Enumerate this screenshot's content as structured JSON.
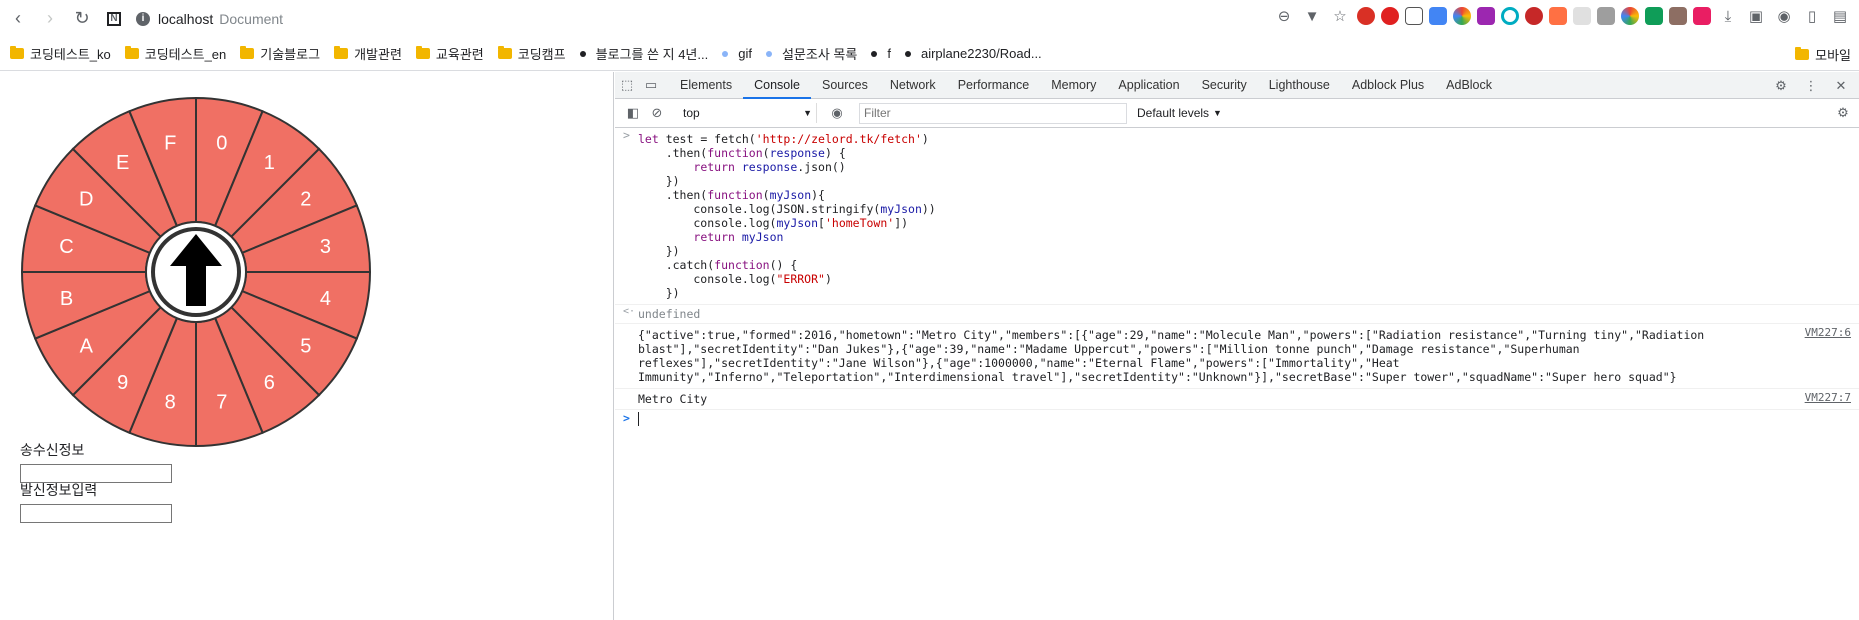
{
  "browser": {
    "host": "localhost",
    "page_title": "Document"
  },
  "bookmarks": [
    {
      "label": "코딩테스트_ko",
      "icon": "folder"
    },
    {
      "label": "코딩테스트_en",
      "icon": "folder"
    },
    {
      "label": "기술블로그",
      "icon": "folder"
    },
    {
      "label": "개발관련",
      "icon": "folder"
    },
    {
      "label": "교육관련",
      "icon": "folder"
    },
    {
      "label": "코딩캠프",
      "icon": "folder"
    },
    {
      "label": "블로그를 쓴 지 4년...",
      "icon": "dot-black"
    },
    {
      "label": "gif",
      "icon": "dot-blue"
    },
    {
      "label": "설문조사 목록",
      "icon": "dot-blue"
    },
    {
      "label": "f",
      "icon": "dot-black"
    },
    {
      "label": "airplane2230/Road...",
      "icon": "dot-black"
    }
  ],
  "bookmarks_right": {
    "label": "모바일",
    "icon": "folder"
  },
  "wheel": {
    "segments": [
      "0",
      "1",
      "2",
      "3",
      "4",
      "5",
      "6",
      "7",
      "8",
      "9",
      "A",
      "B",
      "C",
      "D",
      "E",
      "F"
    ],
    "fill": "#f07064",
    "stroke": "#333333"
  },
  "form": {
    "recv_label": "송수신정보",
    "recv_value": "",
    "send_label": "발신정보입력",
    "send_value": ""
  },
  "devtools": {
    "tabs": [
      "Elements",
      "Console",
      "Sources",
      "Network",
      "Performance",
      "Memory",
      "Application",
      "Security",
      "Lighthouse",
      "Adblock Plus",
      "AdBlock"
    ],
    "active_tab": "Console",
    "context": "top",
    "filter_placeholder": "Filter",
    "levels": "Default levels",
    "console": {
      "input_lines": [
        "let test = fetch('http://zelord.tk/fetch')",
        "    .then(function(response) {",
        "        return response.json()",
        "    })",
        "    .then(function(myJson){",
        "        console.log(JSON.stringify(myJson))",
        "        console.log(myJson['homeTown'])",
        "        return myJson",
        "    })",
        "    .catch(function() {",
        "        console.log(\"ERROR\")",
        "    })"
      ],
      "result": "undefined",
      "log1": "{\"active\":true,\"formed\":2016,\"hometown\":\"Metro City\",\"members\":[{\"age\":29,\"name\":\"Molecule Man\",\"powers\":[\"Radiation resistance\",\"Turning tiny\",\"Radiation blast\"],\"secretIdentity\":\"Dan Jukes\"},{\"age\":39,\"name\":\"Madame Uppercut\",\"powers\":[\"Million tonne punch\",\"Damage resistance\",\"Superhuman reflexes\"],\"secretIdentity\":\"Jane Wilson\"},{\"age\":1000000,\"name\":\"Eternal Flame\",\"powers\":[\"Immortality\",\"Heat Immunity\",\"Inferno\",\"Teleportation\",\"Interdimensional travel\"],\"secretIdentity\":\"Unknown\"}],\"secretBase\":\"Super tower\",\"squadName\":\"Super hero squad\"}",
      "log1_src": "VM227:6",
      "log2": "Metro City",
      "log2_src": "VM227:7"
    }
  }
}
